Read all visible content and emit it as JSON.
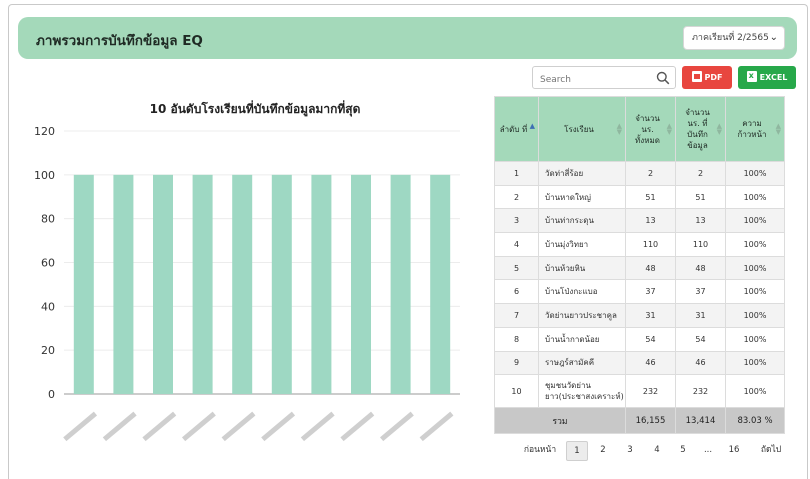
{
  "header": {
    "title": "ภาพรวมการบันทึกข้อมูล EQ",
    "semester_value": "ภาคเรียนที่ 2/2565"
  },
  "toolbar": {
    "search_placeholder": "Search",
    "pdf_label": "PDF",
    "excel_label": "EXCEL"
  },
  "chart_data": {
    "type": "bar",
    "title": "10 อันดับโรงเรียนที่บันทึกข้อมูลมากที่สุด",
    "categories": [
      "",
      "",
      "",
      "",
      "",
      "",
      "",
      "",
      "",
      ""
    ],
    "values": [
      100,
      100,
      100,
      100,
      100,
      100,
      100,
      100,
      100,
      100
    ],
    "y_ticks": [
      "0",
      "20",
      "40",
      "60",
      "80",
      "100",
      "120"
    ],
    "ylim": [
      0,
      120
    ],
    "grid": true,
    "bar_color": "#9ed8c3"
  },
  "table": {
    "headers": {
      "rank": "ลำดับ ที่",
      "school": "โรงเรียน",
      "total": "จำนวน นร. ทั้งหมด",
      "recorded": "จำนวน นร. ที่ บันทึก ข้อมูล",
      "progress": "ความ ก้าวหน้า"
    },
    "rows": [
      {
        "rank": "1",
        "school": "วัดท่าสี่ร้อย",
        "total": "2",
        "recorded": "2",
        "progress": "100%"
      },
      {
        "rank": "2",
        "school": "บ้านหาดใหญ่",
        "total": "51",
        "recorded": "51",
        "progress": "100%"
      },
      {
        "rank": "3",
        "school": "บ้านท่ากระดุน",
        "total": "13",
        "recorded": "13",
        "progress": "100%"
      },
      {
        "rank": "4",
        "school": "บ้านมุ่งวิทยา",
        "total": "110",
        "recorded": "110",
        "progress": "100%"
      },
      {
        "rank": "5",
        "school": "บ้านห้วยหิน",
        "total": "48",
        "recorded": "48",
        "progress": "100%"
      },
      {
        "rank": "6",
        "school": "บ้านโป่งกะแบอ",
        "total": "37",
        "recorded": "37",
        "progress": "100%"
      },
      {
        "rank": "7",
        "school": "วัดย่านยาวประชาคูล",
        "total": "31",
        "recorded": "31",
        "progress": "100%"
      },
      {
        "rank": "8",
        "school": "บ้านน้ำกาดน้อย",
        "total": "54",
        "recorded": "54",
        "progress": "100%"
      },
      {
        "rank": "9",
        "school": "ราษฎร์สามัคคี",
        "total": "46",
        "recorded": "46",
        "progress": "100%"
      },
      {
        "rank": "10",
        "school": "ชุมชนวัดย่าน ยาว(ประชาสงเคราะห์)",
        "total": "232",
        "recorded": "232",
        "progress": "100%"
      }
    ],
    "footer": {
      "label": "รวม",
      "total": "16,155",
      "recorded": "13,414",
      "progress": "83.03 %"
    }
  },
  "pagination": {
    "prev_label": "ก่อนหน้า",
    "pages": [
      "1",
      "2",
      "3",
      "4",
      "5",
      "...",
      "16"
    ],
    "current": "1",
    "next_label": "ถัดไป"
  }
}
